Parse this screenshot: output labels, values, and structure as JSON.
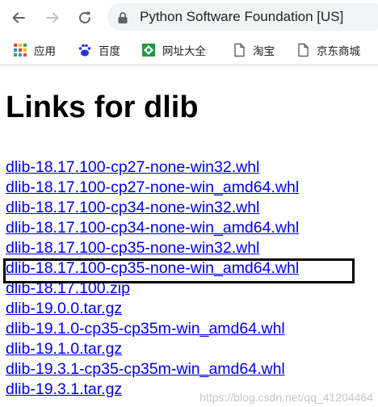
{
  "browser": {
    "address_text": "Python Software Foundation [US]",
    "bookmarks": [
      {
        "label": "应用",
        "icon": "apps-grid-icon"
      },
      {
        "label": "百度",
        "icon": "baidu-paw-icon"
      },
      {
        "label": "网址大全",
        "icon": "site-directory-icon"
      },
      {
        "label": "淘宝",
        "icon": "page-icon"
      },
      {
        "label": "京东商城",
        "icon": "page-icon"
      }
    ]
  },
  "page": {
    "title": "Links for dlib",
    "links": [
      "dlib-18.17.100-cp27-none-win32.whl",
      "dlib-18.17.100-cp27-none-win_amd64.whl",
      "dlib-18.17.100-cp34-none-win32.whl",
      "dlib-18.17.100-cp34-none-win_amd64.whl",
      "dlib-18.17.100-cp35-none-win32.whl",
      "dlib-18.17.100-cp35-none-win_amd64.whl",
      "dlib-18.17.100.zip",
      "dlib-19.0.0.tar.gz",
      "dlib-19.1.0-cp35-cp35m-win_amd64.whl",
      "dlib-19.1.0.tar.gz",
      "dlib-19.3.1-cp35-cp35m-win_amd64.whl",
      "dlib-19.3.1.tar.gz"
    ],
    "highlighted_link": "dlib-18.17.100-cp35-none-win_amd64.whl"
  },
  "watermark": "https://blog.csdn.net/qq_41204464",
  "colors": {
    "link": "#0000ee",
    "highlight_border": "#000000",
    "omnibox_bg": "#f1f3f4"
  }
}
